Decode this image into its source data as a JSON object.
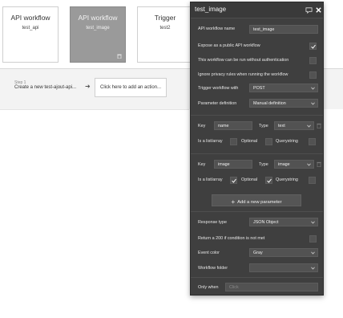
{
  "workflows": [
    {
      "type": "API workflow",
      "name": "test_api",
      "selected": false
    },
    {
      "type": "API workflow",
      "name": "test_image",
      "selected": true
    },
    {
      "type": "Trigger",
      "name": "test2",
      "selected": false
    }
  ],
  "step": {
    "small_label": "Step 1",
    "label": "Create a new test-ajout-api...",
    "add_action": "Click here to add an action..."
  },
  "panel": {
    "title": "test_image",
    "workflow_name_label": "API workflow name",
    "workflow_name_value": "test_image",
    "expose_label": "Expose as a public API workflow",
    "no_auth_label": "This workflow can be run without authentication",
    "ignore_privacy_label": "Ignore privacy rules when running the workflow",
    "trigger_with_label": "Trigger workflow with",
    "trigger_with_value": "POST",
    "param_definition_label": "Parameter definition",
    "param_definition_value": "Manual definition",
    "params": [
      {
        "key_label": "Key",
        "key_value": "name",
        "type_label": "Type",
        "type_value": "text",
        "list_label": "Is a list/array",
        "optional_label": "Optional",
        "querystring_label": "Querystring",
        "list_checked": false,
        "optional_checked": false,
        "querystring_checked": false
      },
      {
        "key_label": "Key",
        "key_value": "image",
        "type_label": "Type",
        "type_value": "image",
        "list_label": "Is a list/array",
        "optional_label": "Optional",
        "querystring_label": "Querystring",
        "list_checked": true,
        "optional_checked": true,
        "querystring_checked": false
      }
    ],
    "add_param_label": "Add a new parameter",
    "response_type_label": "Response type",
    "response_type_value": "JSON Object",
    "return_200_label": "Return a 200 if condition is not met",
    "event_color_label": "Event color",
    "event_color_value": "Gray",
    "folder_label": "Workflow folder",
    "folder_value": "",
    "only_when_label": "Only when",
    "only_when_placeholder": "Click"
  },
  "colors": {
    "panel_bg": "#3f3f3f",
    "field_bg": "#525252",
    "selected_card": "#9a9a9a"
  }
}
